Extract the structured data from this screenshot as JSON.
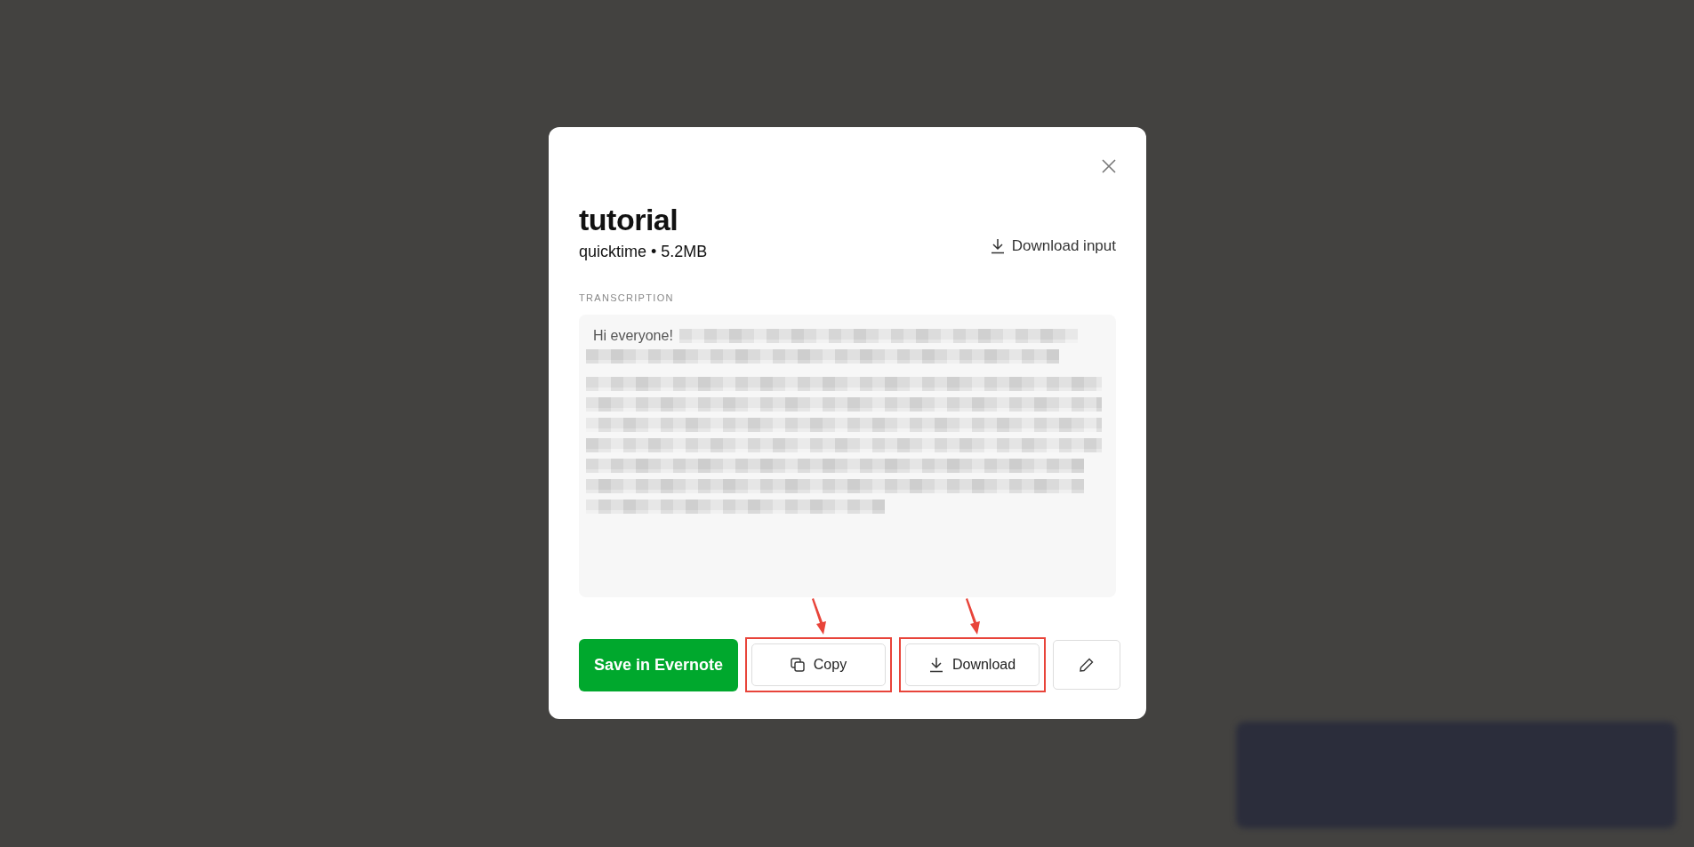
{
  "dialog": {
    "title": "tutorial",
    "subtitle": "quicktime • 5.2MB",
    "download_input": "Download input",
    "section_label": "TRANSCRIPTION",
    "transcription": {
      "visible_text": "Hi everyone!"
    },
    "buttons": [
      {
        "kind": "primary",
        "label": "Save in Evernote",
        "highlighted": false
      },
      {
        "kind": "copy",
        "label": "Copy",
        "highlighted": true
      },
      {
        "kind": "download",
        "label": "Download",
        "highlighted": true
      },
      {
        "kind": "edit",
        "highlighted": false
      }
    ]
  }
}
